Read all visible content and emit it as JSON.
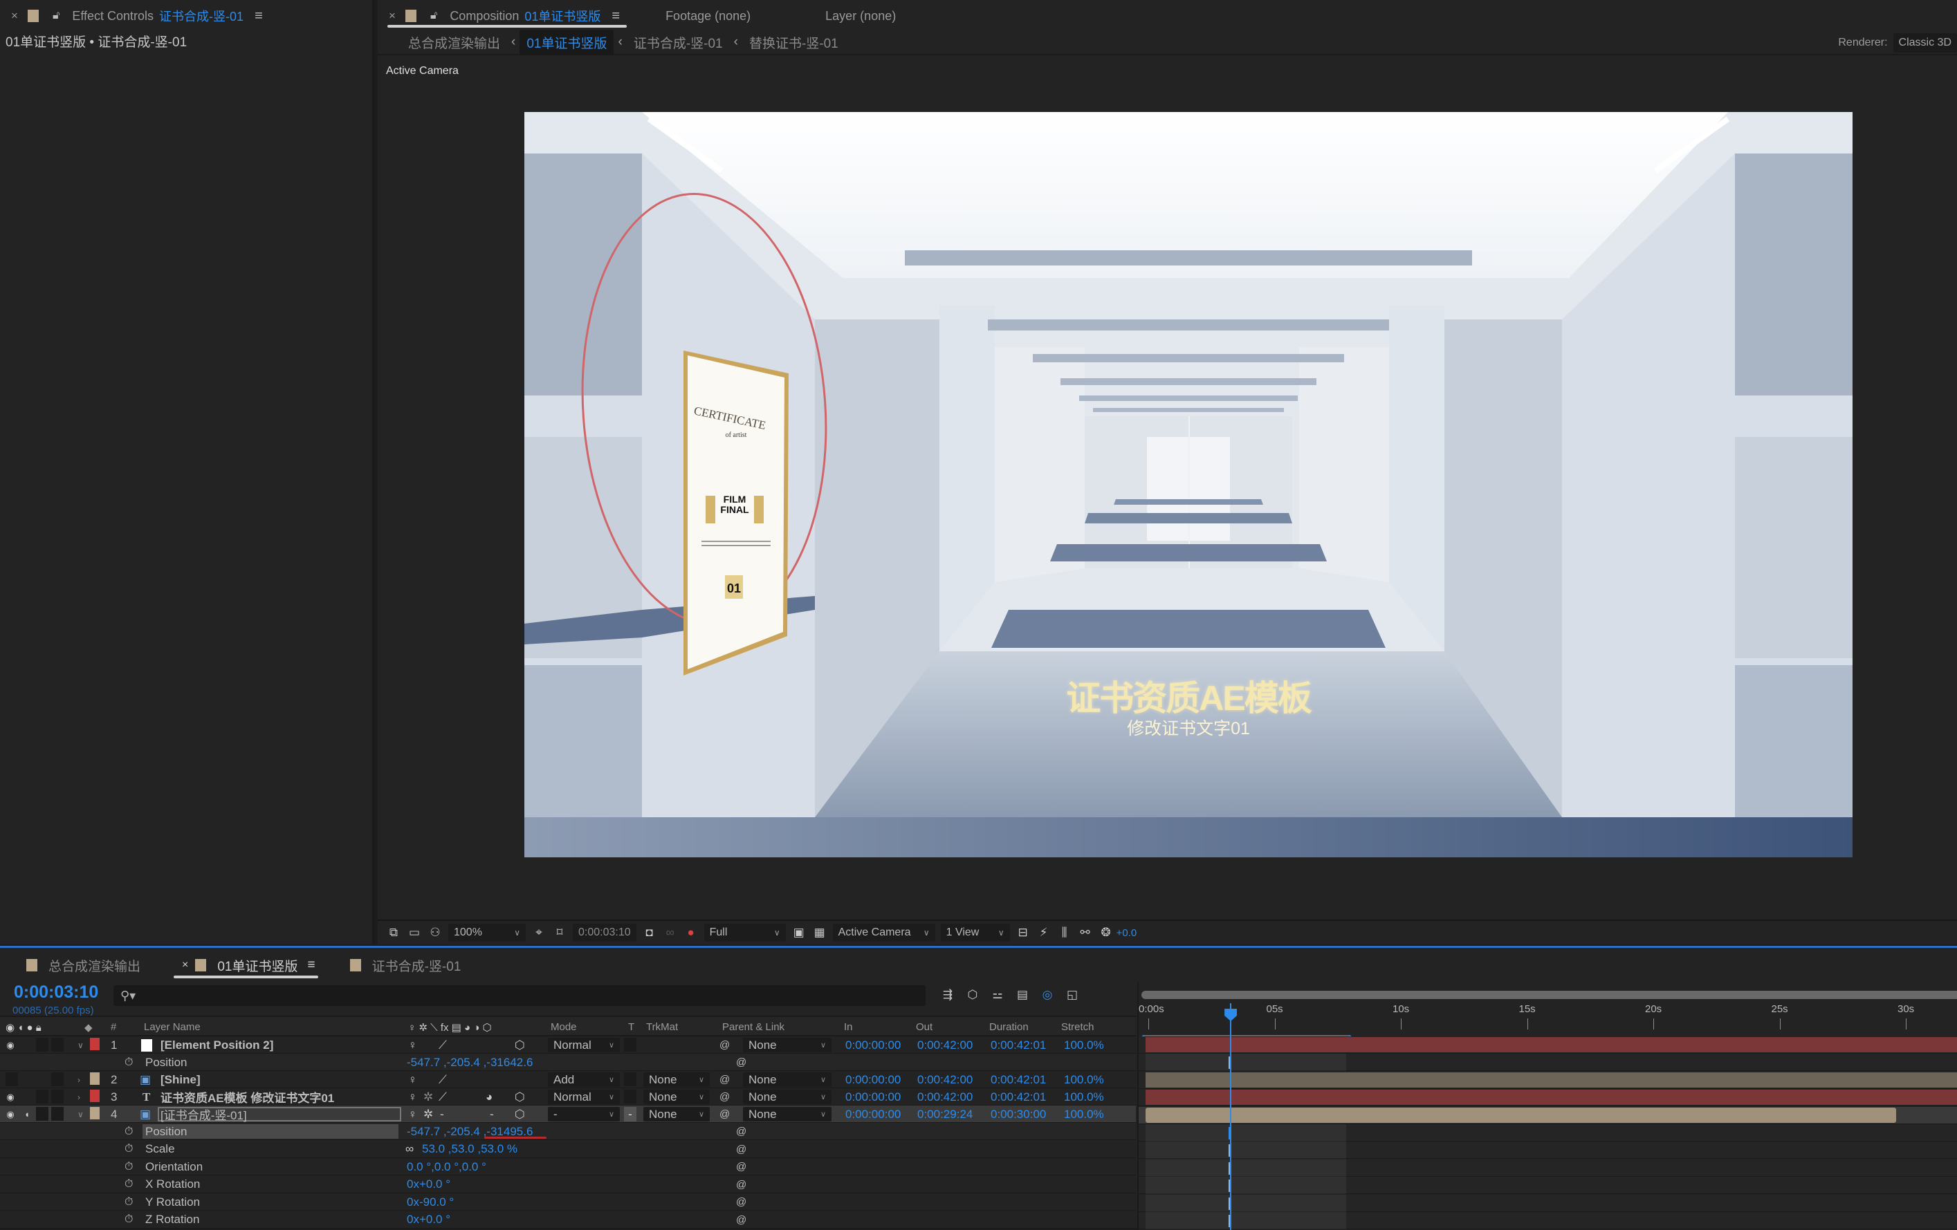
{
  "effect_controls": {
    "tab_label": "Effect Controls",
    "tab_target": "证书合成-竖-01",
    "subtitle": "01单证书竖版 • 证书合成-竖-01"
  },
  "composition": {
    "tab_label": "Composition",
    "tab_target": "01单证书竖版",
    "footage_tab": "Footage  (none)",
    "layer_tab": "Layer  (none)",
    "breadcrumbs": [
      "总合成渲染输出",
      "01单证书竖版",
      "证书合成-竖-01",
      "替换证书-竖-01"
    ],
    "active_breadcrumb": "01单证书竖版",
    "renderer_label": "Renderer:",
    "renderer_value": "Classic 3D",
    "camera_label": "Active Camera",
    "viewer_title": "证书资质AE模板",
    "viewer_subtitle": "修改证书文字01",
    "certificate": {
      "heading": "CERTIFICATE",
      "subheading": "of artist",
      "logo_line1": "FILM",
      "logo_line2": "FINAL",
      "badge": "01"
    }
  },
  "viewer_toolbar": {
    "zoom": "100%",
    "timecode": "0:00:03:10",
    "resolution": "Full",
    "camera": "Active Camera",
    "views": "1 View",
    "exposure": "+0.0"
  },
  "timeline": {
    "tabs": [
      {
        "label": "总合成渲染输出",
        "active": false
      },
      {
        "label": "01单证书竖版",
        "active": true
      },
      {
        "label": "证书合成-竖-01",
        "active": false
      }
    ],
    "current_time": "0:00:03:10",
    "frame_info": "00085 (25.00 fps)",
    "search_placeholder": "",
    "columns": {
      "hash": "#",
      "layer_name": "Layer Name",
      "mode": "Mode",
      "t": "T",
      "trkmat": "TrkMat",
      "parent": "Parent & Link",
      "in": "In",
      "out": "Out",
      "duration": "Duration",
      "stretch": "Stretch"
    },
    "layers": [
      {
        "num": "1",
        "name": "[Element Position 2]",
        "label_color": "#c8393a",
        "mode": "Normal",
        "trkmat": "",
        "parent": "None",
        "in": "0:00:00:00",
        "out": "0:00:42:00",
        "duration": "0:00:42:01",
        "stretch": "100.0%"
      },
      {
        "num": "2",
        "name": "[Shine]",
        "label_color": "#b9a58a",
        "mode": "Add",
        "trkmat": "None",
        "parent": "None",
        "in": "0:00:00:00",
        "out": "0:00:42:00",
        "duration": "0:00:42:01",
        "stretch": "100.0%"
      },
      {
        "num": "3",
        "name": "证书资质AE模板 修改证书文字01",
        "label_color": "#c8393a",
        "mode": "Normal",
        "trkmat": "None",
        "parent": "None",
        "in": "0:00:00:00",
        "out": "0:00:42:00",
        "duration": "0:00:42:01",
        "stretch": "100.0%"
      },
      {
        "num": "4",
        "name": "[证书合成-竖-01]",
        "label_color": "#b9a58a",
        "mode": "-",
        "trkmat": "None",
        "parent": "None",
        "in": "0:00:00:00",
        "out": "0:00:29:24",
        "duration": "0:00:30:00",
        "stretch": "100.0%"
      }
    ],
    "layer1_props": [
      {
        "name": "Position",
        "value": "-547.7 ,-205.4 ,-31642.6"
      }
    ],
    "layer4_props": [
      {
        "name": "Position",
        "value": "-547.7 ,-205.4 ,-31495.6"
      },
      {
        "name": "Scale",
        "value": "53.0 ,53.0 ,53.0 %"
      },
      {
        "name": "Orientation",
        "value": "0.0 °,0.0 °,0.0 °"
      },
      {
        "name": "X Rotation",
        "value": "0x+0.0 °"
      },
      {
        "name": "Y Rotation",
        "value": "0x-90.0 °"
      },
      {
        "name": "Z Rotation",
        "value": "0x+0.0 °"
      }
    ],
    "ruler_labels": [
      "0:00s",
      "05s",
      "10s",
      "15s",
      "20s",
      "25s",
      "30s"
    ],
    "playhead_seconds": 3.4,
    "colors": {
      "accent": "#2d8ceb",
      "red_layer_bar": "#7b3638",
      "tan_layer_bar": "#6c6456",
      "selected_layer_bar": "#a0927a"
    }
  }
}
